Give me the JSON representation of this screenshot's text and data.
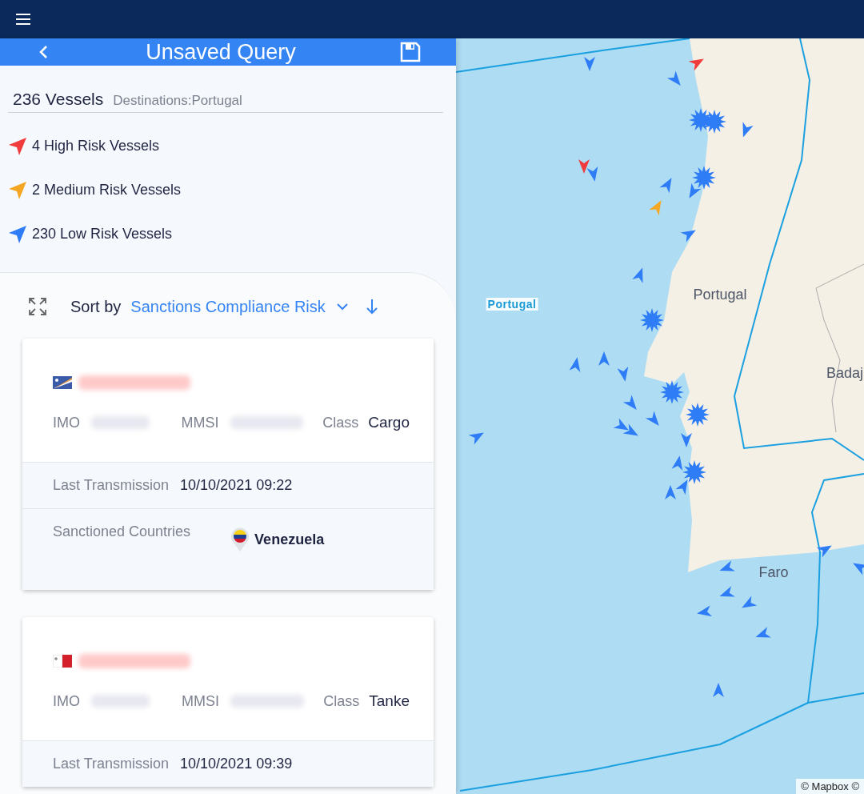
{
  "query_header": {
    "title": "Unsaved Query"
  },
  "summary": {
    "count": "236 Vessels",
    "filter": "Destinations:Portugal",
    "risk_groups": [
      {
        "label": "4 High Risk Vessels",
        "color": "#f03c3c"
      },
      {
        "label": "2 Medium Risk Vessels",
        "color": "#f5a623"
      },
      {
        "label": "230 Low Risk Vessels",
        "color": "#2e7cf6"
      }
    ]
  },
  "sort": {
    "label": "Sort by",
    "value": "Sanctions Compliance Risk"
  },
  "vessels": [
    {
      "kind": "marshall-islands",
      "imo_label": "IMO",
      "mmsi_label": "MMSI",
      "class_label": "Class",
      "class": "Cargo",
      "transmission_label": "Last Transmission",
      "transmission": "10/10/2021 09:22",
      "sanctions_label": "Sanctioned Countries",
      "sanctioned_country": "Venezuela"
    },
    {
      "kind": "malta",
      "imo_label": "IMO",
      "mmsi_label": "MMSI",
      "class_label": "Class",
      "class": "Tanke",
      "transmission_label": "Last Transmission",
      "transmission": "10/10/2021 09:39"
    }
  ],
  "map": {
    "labels": [
      {
        "text": "Portugal",
        "kind": "sea"
      },
      {
        "text": "Portugal",
        "kind": "land"
      },
      {
        "text": "Badaj",
        "kind": "land"
      },
      {
        "text": "Faro",
        "kind": "land"
      }
    ],
    "attribution": "© Mapbox ©"
  }
}
